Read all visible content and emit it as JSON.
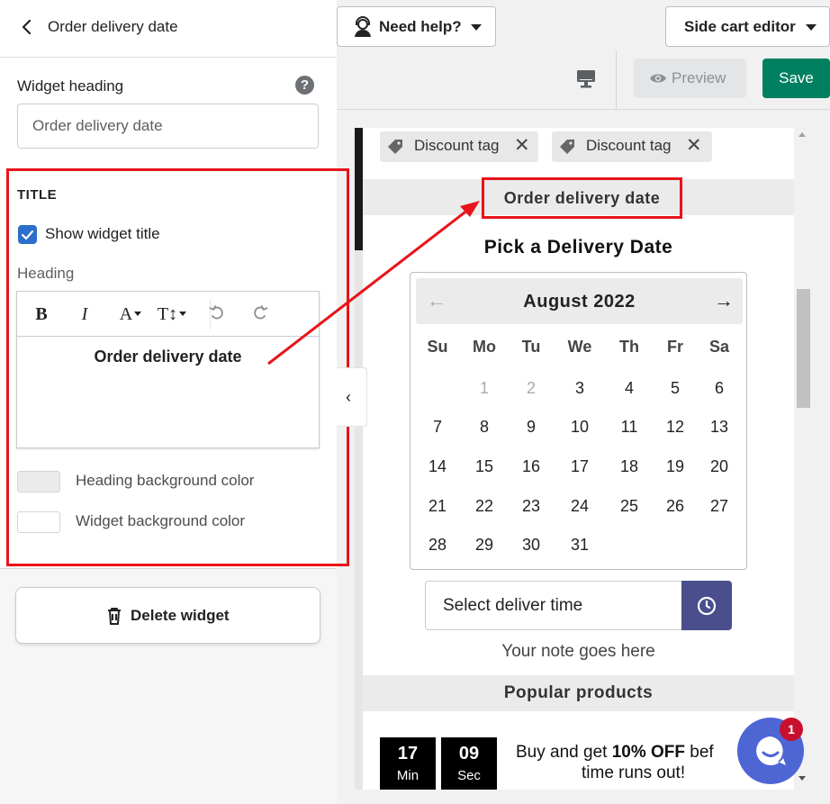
{
  "left_panel": {
    "header_title": "Order delivery date",
    "widget_heading_label": "Widget heading",
    "widget_heading_value": "Order delivery date",
    "title_section": "TITLE",
    "show_widget_title_label": "Show widget title",
    "show_widget_title_checked": true,
    "heading_label": "Heading",
    "editor_text": "Order delivery date",
    "toolbar": {
      "bold": "B",
      "italic": "I",
      "font_color": "A",
      "text_size": "T↕"
    },
    "heading_bg_label": "Heading background color",
    "heading_bg_color": "#ebebeb",
    "widget_bg_label": "Widget background color",
    "widget_bg_color": "#ffffff",
    "delete_label": "Delete widget"
  },
  "topbar": {
    "help_label": "Need help?",
    "side_cart_label": "Side cart editor",
    "preview_label": "Preview",
    "save_label": "Save"
  },
  "preview": {
    "tags": [
      "Discount tag",
      "Discount tag"
    ],
    "order_title": "Order delivery date",
    "pick_title": "Pick a Delivery Date",
    "calendar": {
      "month": "August 2022",
      "weekdays": [
        "Su",
        "Mo",
        "Tu",
        "We",
        "Th",
        "Fr",
        "Sa"
      ],
      "weeks": [
        [
          "",
          "1",
          "2",
          "3",
          "4",
          "5",
          "6"
        ],
        [
          "7",
          "8",
          "9",
          "10",
          "11",
          "12",
          "13"
        ],
        [
          "14",
          "15",
          "16",
          "17",
          "18",
          "19",
          "20"
        ],
        [
          "21",
          "22",
          "23",
          "24",
          "25",
          "26",
          "27"
        ],
        [
          "28",
          "29",
          "30",
          "31",
          "",
          "",
          ""
        ]
      ],
      "disabled_days": [
        "1",
        "2"
      ]
    },
    "time_placeholder": "Select deliver time",
    "note": "Your note goes here",
    "popular_title": "Popular products",
    "timer": {
      "minutes": "17",
      "minutes_unit": "Min",
      "seconds": "09",
      "seconds_unit": "Sec"
    },
    "promo_line1_pre": "Buy and get ",
    "promo_line1_bold": "10% OFF",
    "promo_line1_post": " bef",
    "promo_line2": "time runs out!",
    "chat_badge": "1"
  },
  "colors": {
    "save": "#008060",
    "checkbox": "#2c6ecb",
    "highlight": "#e8141b",
    "time_button": "#4a4e8c",
    "chat": "#4e65d4"
  }
}
